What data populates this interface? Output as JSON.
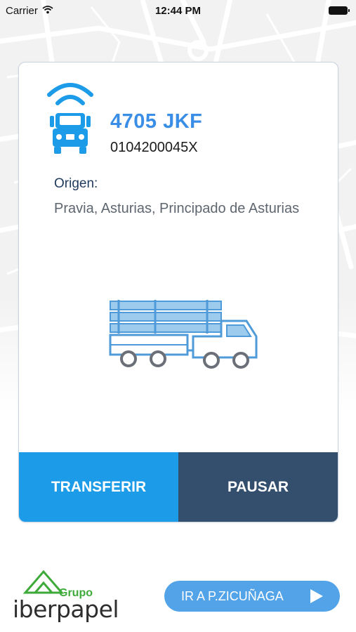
{
  "status_bar": {
    "carrier": "Carrier",
    "time": "12:44 PM"
  },
  "vehicle": {
    "plate": "4705 JKF",
    "code": "0104200045X"
  },
  "origin": {
    "label": "Origen:",
    "value": "Pravia, Asturias, Principado de Asturias"
  },
  "actions": {
    "transfer_label": "TRANSFERIR",
    "pause_label": "PAUSAR"
  },
  "footer": {
    "logo_small": "Grupo",
    "logo_main": "iberpapel",
    "goto_label": "IR A P.ZICUÑAGA"
  },
  "colors": {
    "plate_blue": "#3a8ee6",
    "transfer_blue": "#1b9be8",
    "pause_navy": "#344f6e",
    "goto_blue": "#52a3e8",
    "logo_green": "#3daa3a"
  },
  "icons": [
    "wifi-icon",
    "truck-front-icon",
    "logging-truck-icon",
    "play-icon"
  ]
}
